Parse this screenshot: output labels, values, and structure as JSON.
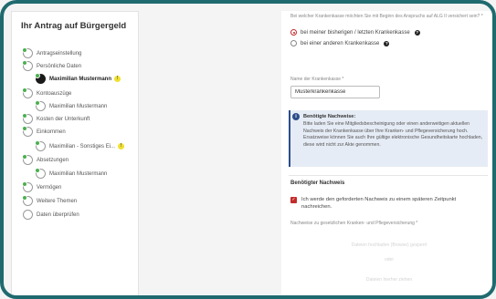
{
  "sidebar": {
    "title": "Ihr Antrag auf Bürgergeld",
    "items": [
      {
        "label": "Antragseinstellung"
      },
      {
        "label": "Persönliche Daten"
      },
      {
        "label": "Maximilian Mustermann",
        "badge": "!"
      },
      {
        "label": "Kontoauszüge"
      },
      {
        "label": "Maximilian Mustermann"
      },
      {
        "label": "Kosten der Unterkunft"
      },
      {
        "label": "Einkommen"
      },
      {
        "label": "Maximilian - Sonstiges Ei...",
        "badge": "!"
      },
      {
        "label": "Absetzungen"
      },
      {
        "label": "Maximilian Mustermann"
      },
      {
        "label": "Vermögen"
      },
      {
        "label": "Weitere Themen"
      },
      {
        "label": "Daten überprüfen"
      }
    ]
  },
  "form": {
    "question": "Bei welcher Krankenkasse möchten Sie mit Beginn des Anspruchs auf ALG II versichert sein? *",
    "options": [
      {
        "label": "bei meiner bisherigen / letzten Krankenkasse",
        "selected": true
      },
      {
        "label": "bei einer anderen Krankenkasse",
        "selected": false
      }
    ],
    "help_glyph": "?",
    "insurer_label": "Name der Krankenkasse *",
    "insurer_value": "Musterkrankenkasse",
    "info": {
      "icon": "i",
      "title": "Benötigte Nachweise:",
      "body": "Bitte laden Sie eine Mitgliedsbescheinigung oder einen anderweitigen aktuellen Nachweis der Krankenkasse über Ihre Kranken- und Pflegeversicherung hoch. Ersatzweise können Sie auch Ihre gültige elektronische Gesundheitskarte hochladen, diese wird nicht zur Akte genommen."
    },
    "proof_section_title": "Benötigter Nachweis",
    "later_checkbox": {
      "label": "Ich werde den geforderten Nachweis zu einem späteren Zeitpunkt nachreichen.",
      "checked": true,
      "glyph": "✓"
    },
    "upload_label": "Nachweise zu gesetzlichen Kranken- und Pflegeversicherung *",
    "upload_hint_1": "Dateien hochladen (Browse) gesperrt",
    "upload_hint_2": "oder",
    "upload_hint_3": "Dateien hierher ziehen"
  },
  "colors": {
    "frame": "#1f6a6f",
    "accent_red": "#c42a2a",
    "info_blue": "#2b4d8c",
    "check_green": "#4caf50",
    "warn_yellow": "#f0e030"
  }
}
